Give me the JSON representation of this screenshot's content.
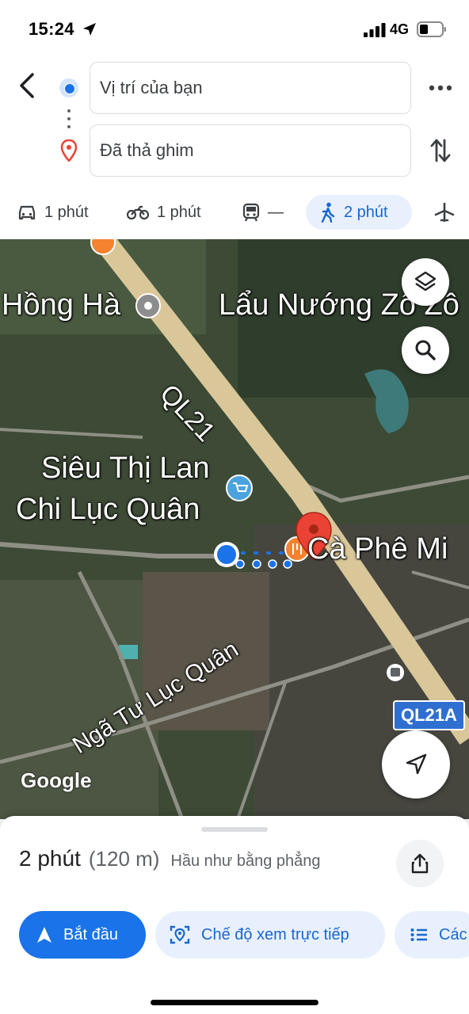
{
  "status_bar": {
    "time": "15:24",
    "network": "4G",
    "icons": [
      "location-arrow-icon",
      "signal-icon",
      "battery-icon"
    ]
  },
  "header": {
    "back_icon": "back-arrow-icon",
    "origin": {
      "value": "Vị trí của bạn",
      "icon": "origin-dot-icon"
    },
    "destination": {
      "value": "Đã thả ghim",
      "icon": "red-pin-icon"
    },
    "more_icon": "more-horizontal-icon",
    "swap_icon": "swap-vertical-icon"
  },
  "travel_modes": [
    {
      "mode": "car",
      "icon": "car-icon",
      "label": "1 phút"
    },
    {
      "mode": "motorbike",
      "icon": "motorbike-icon",
      "label": "1 phút"
    },
    {
      "mode": "transit",
      "icon": "train-icon",
      "label": "—"
    },
    {
      "mode": "walk",
      "icon": "walk-icon",
      "label": "2 phút",
      "selected": true
    },
    {
      "mode": "flight",
      "icon": "plane-icon",
      "label": ""
    }
  ],
  "map": {
    "labels": {
      "hong_ha": "Hồng Hà",
      "lau_nuong": "Lẩu Nướng Zô Zô",
      "sieu_thi_line1": "Siêu Thị Lan",
      "sieu_thi_line2": "Chi Lục Quân",
      "ca_phe": "Cà Phê Mi",
      "road_ql21": "QL21",
      "nga_tu": "Ngã Tư Lục Quân",
      "shield_ql21a": "QL21A",
      "watermark": "Google"
    },
    "buttons": [
      "layers-icon",
      "search-icon",
      "navigate-arrow-icon"
    ],
    "colors": {
      "road": "#d9c79a",
      "route": "#1a73e8",
      "pin": "#ea4335"
    }
  },
  "sheet": {
    "duration": "2 phút",
    "distance": "(120 m)",
    "terrain": "Hầu như bằng phẳng",
    "share_icon": "share-icon",
    "actions": {
      "start": "Bắt đầu",
      "live_view": "Chế độ xem trực tiếp",
      "steps": "Các"
    }
  }
}
